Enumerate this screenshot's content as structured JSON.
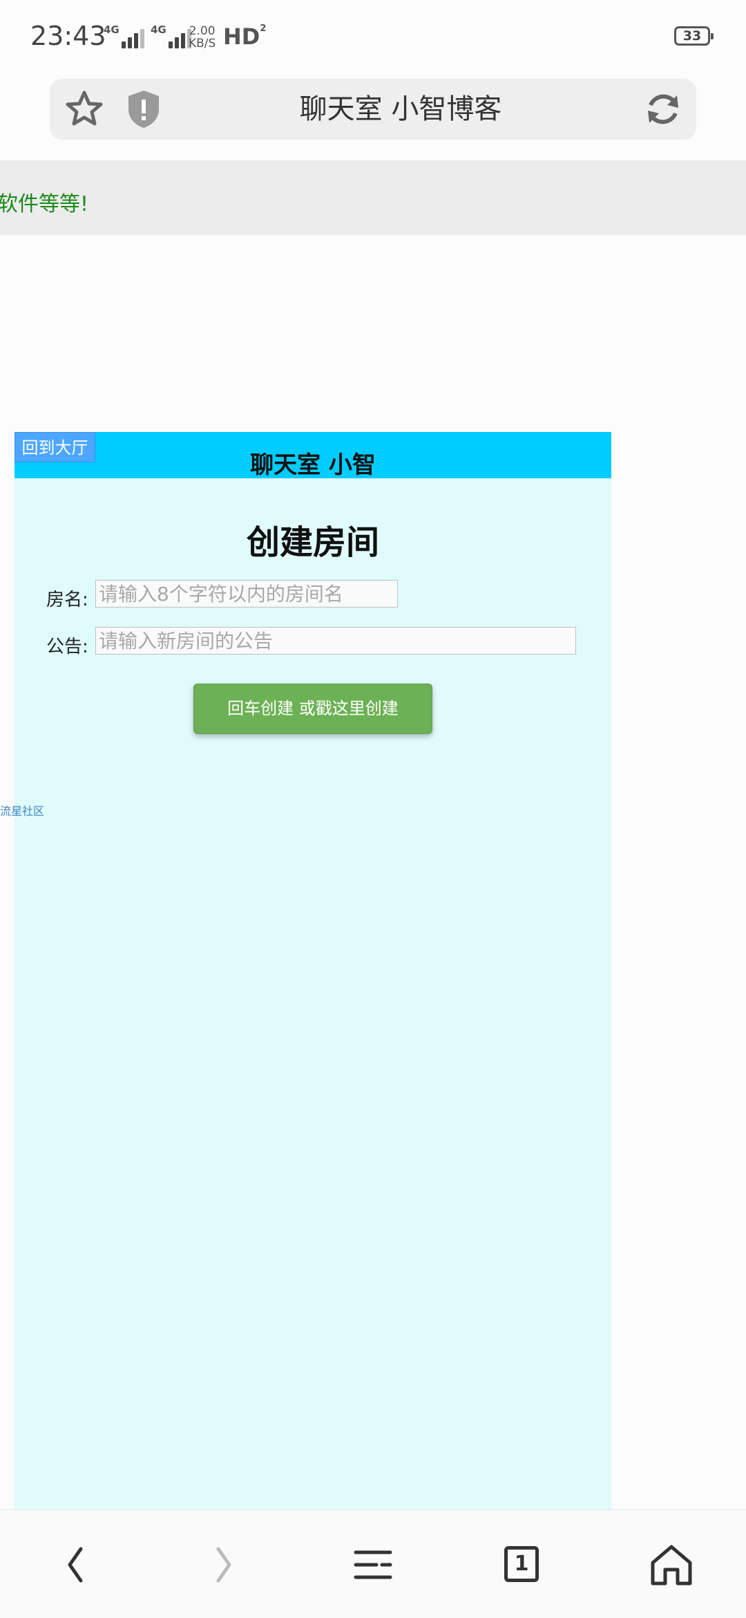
{
  "status": {
    "time": "23:43",
    "signal1": "4G",
    "signal2": "4G",
    "speed_value": "2.00",
    "speed_unit": "KB/S",
    "hd": "HD",
    "battery": "33"
  },
  "browser": {
    "title": "聊天室 小智博客",
    "icons": [
      "star-icon",
      "shield-icon",
      "reload-icon"
    ]
  },
  "marquee": {
    "text": "软件等等!"
  },
  "chat": {
    "back_label": "回到大厅",
    "title": "聊天室 小智",
    "heading": "创建房间",
    "room_name_label": "房名:",
    "room_name_placeholder": "请输入8个字符以内的房间名",
    "notice_label": "公告:",
    "notice_placeholder": "请输入新房间的公告",
    "create_button": "回车创建 或戳这里创建",
    "side_link": "流星社区"
  },
  "colors": {
    "header": "#00ccff",
    "panel": "#e0fbfb",
    "back_button": "#4da6ff",
    "create_button": "#6cb155",
    "marquee_text": "#1a8a1a"
  },
  "bottom_nav": {
    "items": [
      "back-icon",
      "forward-icon",
      "menu-icon",
      "tabs-icon",
      "home-icon"
    ],
    "tab_count": "1"
  }
}
